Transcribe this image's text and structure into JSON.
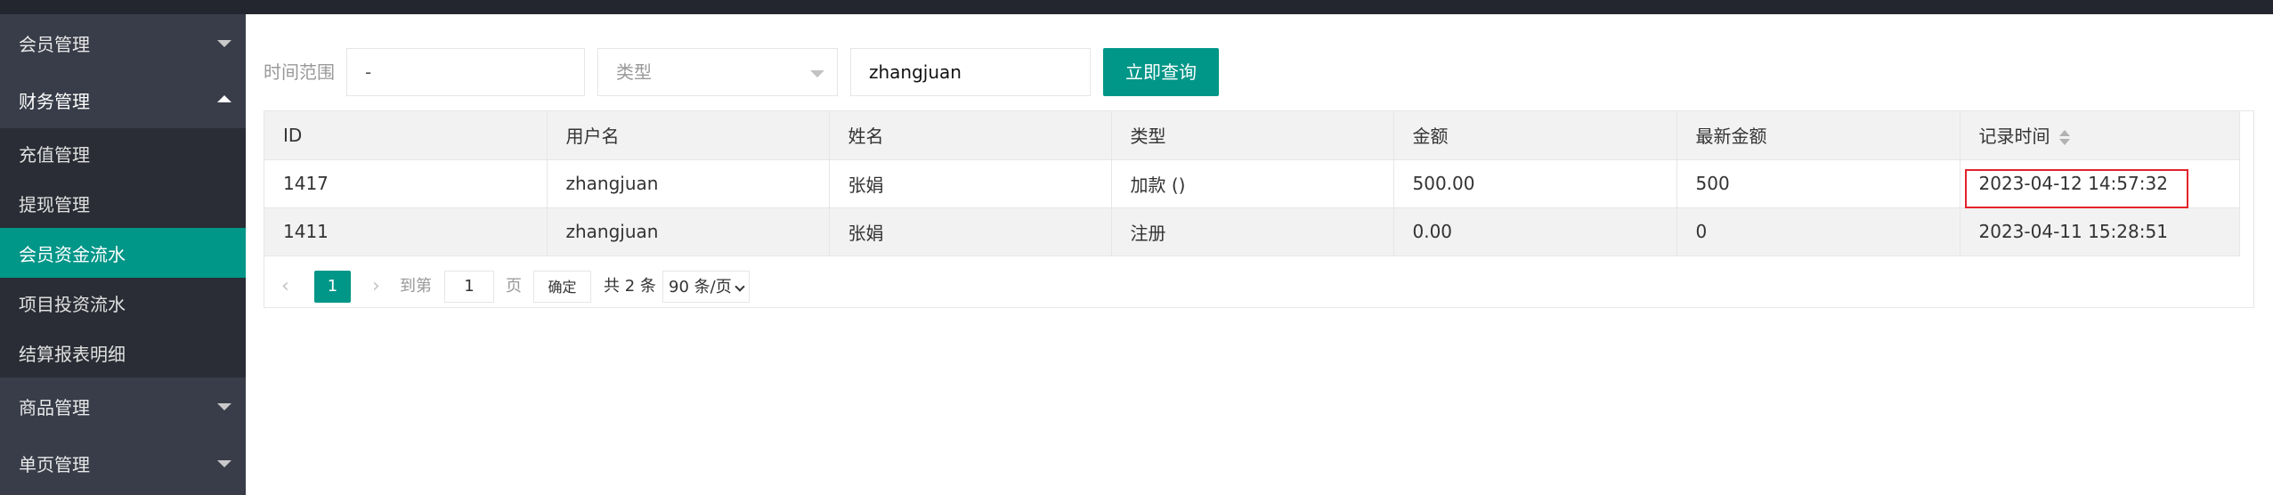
{
  "sidebar": {
    "groups": [
      {
        "label": "会员管理"
      },
      {
        "label": "财务管理"
      },
      {
        "label": "商品管理"
      },
      {
        "label": "单页管理"
      }
    ],
    "finance_items": [
      {
        "label": "充值管理"
      },
      {
        "label": "提现管理"
      },
      {
        "label": "会员资金流水"
      },
      {
        "label": "项目投资流水"
      },
      {
        "label": "结算报表明细"
      }
    ]
  },
  "filters": {
    "time_label": "时间范围",
    "date_range_value": "-",
    "type_placeholder": "类型",
    "name_value": "zhangjuan",
    "query_button": "立即查询"
  },
  "table": {
    "columns": [
      "ID",
      "用户名",
      "姓名",
      "类型",
      "金额",
      "最新金额",
      "记录时间"
    ],
    "rows": [
      [
        "1417",
        "zhangjuan",
        "张娟",
        "加款 ()",
        "500.00",
        "500",
        "2023-04-12 14:57:32"
      ],
      [
        "1411",
        "zhangjuan",
        "张娟",
        "注册",
        "0.00",
        "0",
        "2023-04-11 15:28:51"
      ]
    ]
  },
  "pager": {
    "prev_icon": "‹",
    "current_page": "1",
    "next_icon": "›",
    "goto_label": "到第",
    "goto_value": "1",
    "page_label": "页",
    "confirm_button": "确定",
    "total_text": "共 2 条",
    "page_size": "90 条/页"
  },
  "colors": {
    "accent": "#009688",
    "sidebar_bg": "#393d49",
    "sidebar_sub_bg": "#2a2d35",
    "topbar_bg": "#23262e",
    "highlight": "#e3222b"
  }
}
